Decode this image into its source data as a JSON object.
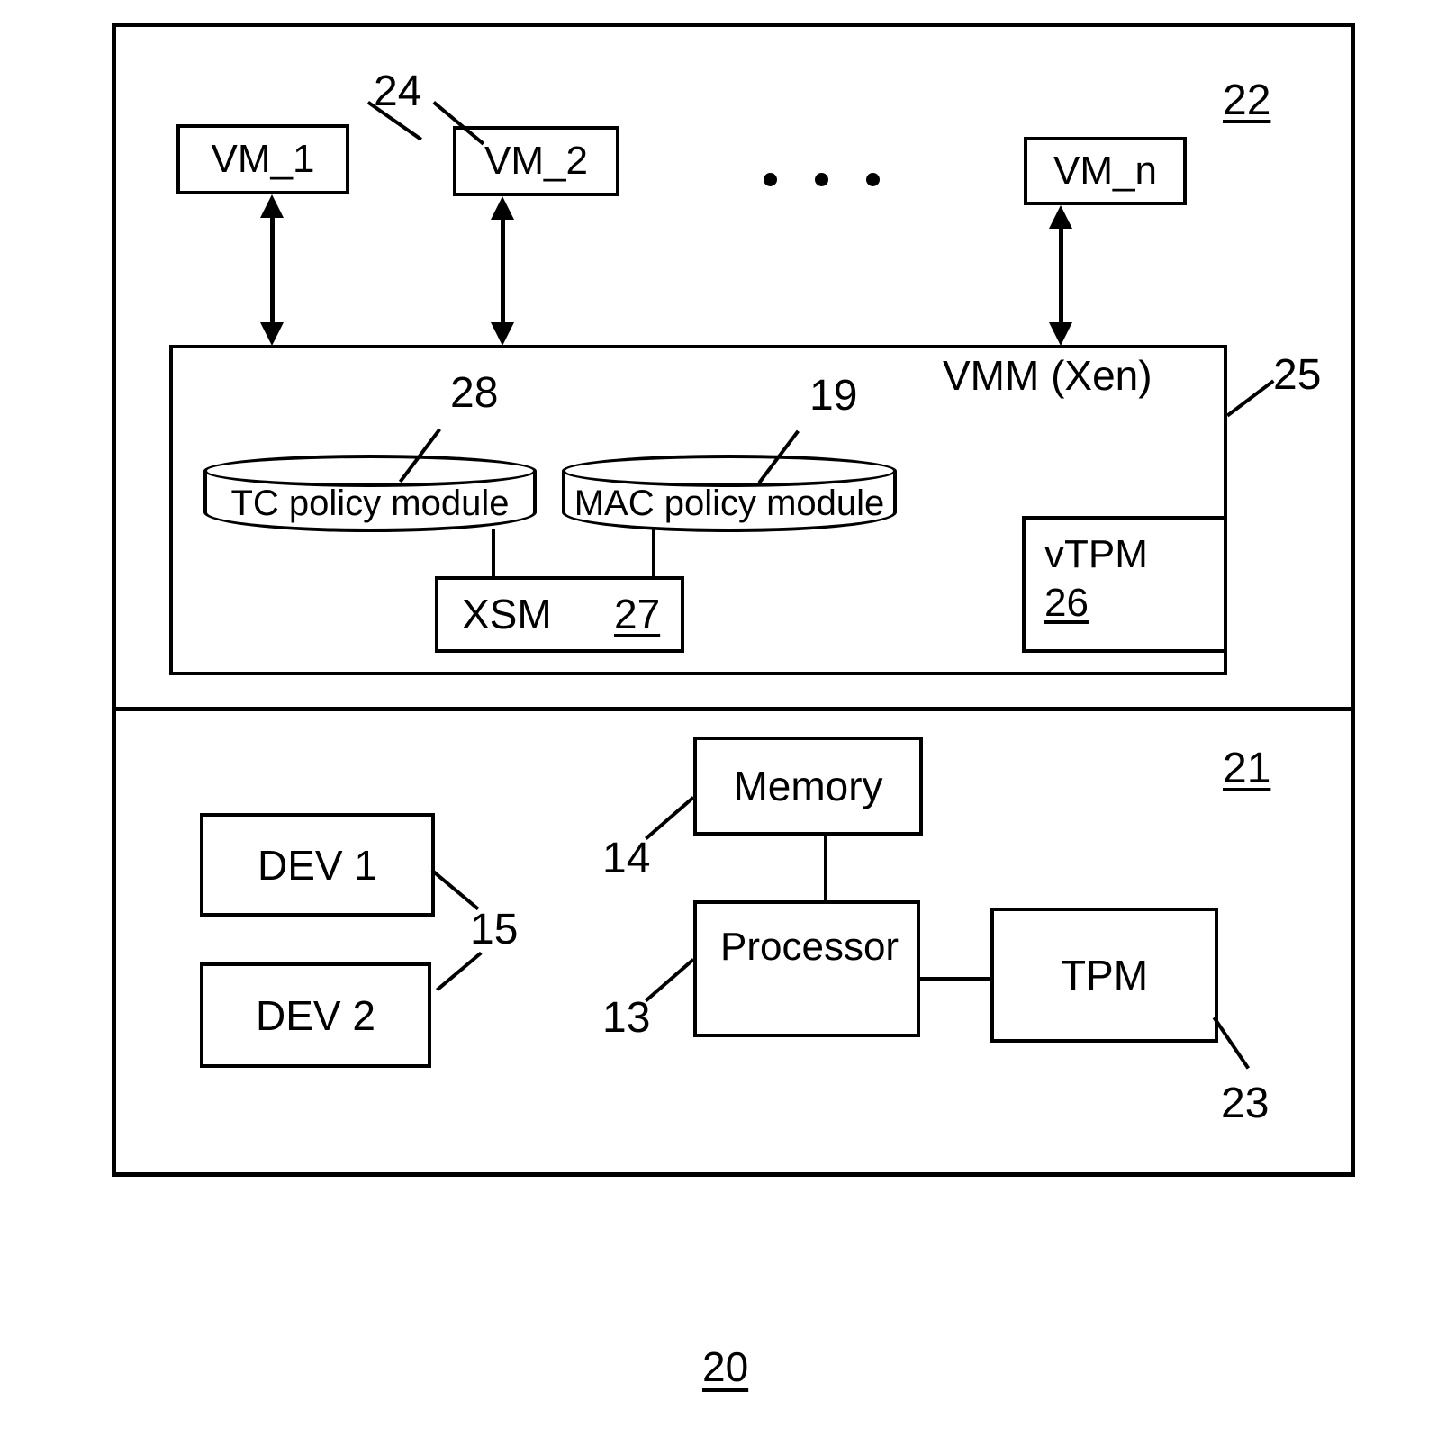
{
  "figure": {
    "figure_number": "20",
    "outer_frame_name": "system-20"
  },
  "software_layer": {
    "ref": "22",
    "virtual_machines": [
      {
        "label": "VM_1"
      },
      {
        "label": "VM_2"
      },
      {
        "label": "VM_n"
      }
    ],
    "vm_group_ref": "24",
    "ellipsis": "· · ·",
    "vmm": {
      "title": "VMM (Xen)",
      "ref": "25",
      "modules": [
        {
          "label": "TC policy module",
          "ref": "28"
        },
        {
          "label": "MAC policy module",
          "ref": "19"
        }
      ],
      "xsm": {
        "label": "XSM",
        "ref": "27"
      },
      "vtpm": {
        "label": "vTPM",
        "ref": "26"
      }
    }
  },
  "hardware_layer": {
    "ref": "21",
    "devices": [
      {
        "label": "DEV 1"
      },
      {
        "label": "DEV 2"
      }
    ],
    "devices_ref": "15",
    "memory": {
      "label": "Memory",
      "ref": "14"
    },
    "processor": {
      "label": "Processor",
      "ref": "13"
    },
    "tpm": {
      "label": "TPM",
      "ref": "23"
    }
  }
}
